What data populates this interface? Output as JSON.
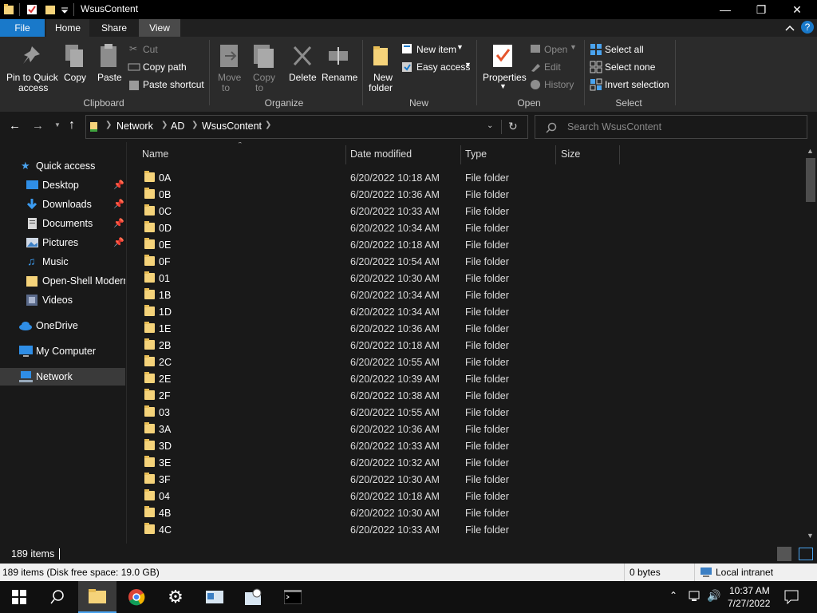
{
  "window": {
    "title": "WsusContent"
  },
  "ribbon_tabs": [
    "File",
    "Home",
    "Share",
    "View"
  ],
  "ribbon": {
    "clipboard": {
      "pin": "Pin to Quick access",
      "pin_line1": "Pin to Quick",
      "pin_line2": "access",
      "copy": "Copy",
      "paste": "Paste",
      "cut": "Cut",
      "copy_path": "Copy path",
      "paste_shortcut": "Paste shortcut",
      "label": "Clipboard"
    },
    "organize": {
      "move1": "Move",
      "move2": "to",
      "copy1": "Copy",
      "copy2": "to",
      "delete": "Delete",
      "rename": "Rename",
      "label": "Organize"
    },
    "new": {
      "folder1": "New",
      "folder2": "folder",
      "new_item": "New item",
      "easy_access": "Easy access",
      "label": "New"
    },
    "open": {
      "properties": "Properties",
      "open": "Open",
      "edit": "Edit",
      "history": "History",
      "label": "Open"
    },
    "select": {
      "all": "Select all",
      "none": "Select none",
      "invert": "Invert selection",
      "label": "Select"
    }
  },
  "address": {
    "crumbs": [
      "Network",
      "AD",
      "WsusContent"
    ],
    "search_placeholder": "Search WsusContent"
  },
  "navpane": {
    "quick_access": "Quick access",
    "items": [
      "Desktop",
      "Downloads",
      "Documents",
      "Pictures",
      "Music",
      "Open-Shell Modern",
      "Videos"
    ],
    "onedrive": "OneDrive",
    "my_computer": "My Computer",
    "network": "Network"
  },
  "columns": [
    "Name",
    "Date modified",
    "Type",
    "Size"
  ],
  "files": [
    {
      "name": "0A",
      "date": "6/20/2022 10:18 AM",
      "type": "File folder"
    },
    {
      "name": "0B",
      "date": "6/20/2022 10:36 AM",
      "type": "File folder"
    },
    {
      "name": "0C",
      "date": "6/20/2022 10:33 AM",
      "type": "File folder"
    },
    {
      "name": "0D",
      "date": "6/20/2022 10:34 AM",
      "type": "File folder"
    },
    {
      "name": "0E",
      "date": "6/20/2022 10:18 AM",
      "type": "File folder"
    },
    {
      "name": "0F",
      "date": "6/20/2022 10:54 AM",
      "type": "File folder"
    },
    {
      "name": "01",
      "date": "6/20/2022 10:30 AM",
      "type": "File folder"
    },
    {
      "name": "1B",
      "date": "6/20/2022 10:34 AM",
      "type": "File folder"
    },
    {
      "name": "1D",
      "date": "6/20/2022 10:34 AM",
      "type": "File folder"
    },
    {
      "name": "1E",
      "date": "6/20/2022 10:36 AM",
      "type": "File folder"
    },
    {
      "name": "2B",
      "date": "6/20/2022 10:18 AM",
      "type": "File folder"
    },
    {
      "name": "2C",
      "date": "6/20/2022 10:55 AM",
      "type": "File folder"
    },
    {
      "name": "2E",
      "date": "6/20/2022 10:39 AM",
      "type": "File folder"
    },
    {
      "name": "2F",
      "date": "6/20/2022 10:38 AM",
      "type": "File folder"
    },
    {
      "name": "03",
      "date": "6/20/2022 10:55 AM",
      "type": "File folder"
    },
    {
      "name": "3A",
      "date": "6/20/2022 10:36 AM",
      "type": "File folder"
    },
    {
      "name": "3D",
      "date": "6/20/2022 10:33 AM",
      "type": "File folder"
    },
    {
      "name": "3E",
      "date": "6/20/2022 10:32 AM",
      "type": "File folder"
    },
    {
      "name": "3F",
      "date": "6/20/2022 10:30 AM",
      "type": "File folder"
    },
    {
      "name": "04",
      "date": "6/20/2022 10:18 AM",
      "type": "File folder"
    },
    {
      "name": "4B",
      "date": "6/20/2022 10:30 AM",
      "type": "File folder"
    },
    {
      "name": "4C",
      "date": "6/20/2022 10:33 AM",
      "type": "File folder"
    }
  ],
  "status": {
    "count": "189 items",
    "detail": "189 items (Disk free space: 19.0 GB)",
    "bytes": "0 bytes",
    "zone": "Local intranet"
  },
  "clock": {
    "time": "10:37 AM",
    "date": "7/27/2022"
  },
  "colors": {
    "accent": "#0078d7",
    "folder": "#f5d37a"
  }
}
